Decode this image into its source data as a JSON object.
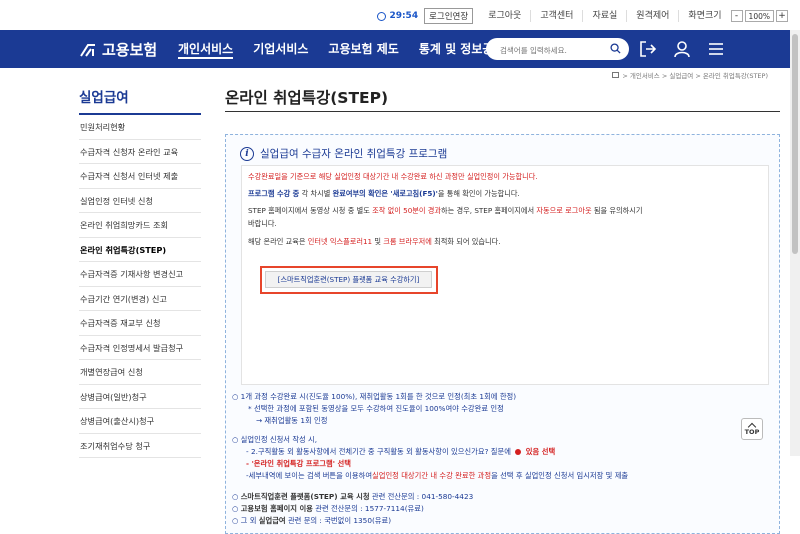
{
  "topbar": {
    "timer": "29:54",
    "extend": "로그인연장",
    "logout": "로그아웃",
    "customer": "고객센터",
    "library": "자료실",
    "remote": "원격제어",
    "screen": "화면크기",
    "zoom_minus": "-",
    "zoom_value": "100%",
    "zoom_plus": "+"
  },
  "nav": {
    "logo": "고용보험",
    "menu": [
      "개인서비스",
      "기업서비스",
      "고용보험 제도",
      "통계 및 정보공개"
    ],
    "search_placeholder": "검색어를 입력하세요."
  },
  "breadcrumb": "> 개인서비스 > 실업급여 > 온라인 취업특강(STEP)",
  "sidebar": {
    "title": "실업급여",
    "items": [
      "민원처리현황",
      "수급자격 신청자 온라인 교육",
      "수급자격 신청서 인터넷 제출",
      "실업인정 인터넷 신청",
      "온라인 취업희망카드 조회",
      "온라인 취업특강(STEP)",
      "수급자격증 기재사항 변경신고",
      "수급기간 연기(변경) 신고",
      "수급자격증 재교부 신청",
      "수급자격 인정명세서 발급청구",
      "개별연장급여 신청",
      "상병급여(일반)청구",
      "상병급여(출산시)청구",
      "조기재취업수당 청구"
    ]
  },
  "main": {
    "title": "온라인 취업특강(STEP)",
    "box_title": "실업급여 수급자 온라인 취업특강 프로그램",
    "line1": "수강완료일을 기준으로 해당 실업인정 대상기간 내 수강완료 하신 과정만 실업인정이 가능합니다.",
    "line2a": "프로그램 수강 중",
    "line2b": " 각 차시별 ",
    "line2c": "완료여부의 확인은 '새로고침(F5)'",
    "line2d": "을 통해 확인이 가능합니다.",
    "line3a": "STEP 홈페이지에서 동영상 시청 중 별도 ",
    "line3b": "조작 없이 50분이 경과",
    "line3c": "하는 경우, STEP 홈페이지에서 ",
    "line3d": "자동으로 로그아웃",
    "line3e": " 됨을 유의하시기",
    "line3f": "바랍니다.",
    "line4a": "해당 온라인 교육은 ",
    "line4b": "인터넷 익스플로러11",
    "line4c": " 및 ",
    "line4d": "크롬 브라우저에",
    "line4e": " 최적화 되어 있습니다.",
    "cta": "[스마트직업훈련(STEP) 플랫폼 교육 수강하기]",
    "b1": "○ 1개 과정 수강완료 시(진도율 100%), 재취업활동 1회를 한 것으로 인정(최초 1회에 한정)",
    "b1s": "* 선택한 과정에 포함된 동영상을 모두 수강하여 진도율이 100%여야 수강완료 인정",
    "b1s2": "→ 재취업활동 1회 인정",
    "b2": "○ 실업인정 신청서 작성 시,",
    "b2a1": "- 2.구직활동 외 활동사항에서 전체기간 중 구직활동 외 활동사항이 있으신가요? 질문에 ",
    "b2a2": " 있음 선택",
    "b2b": "- '온라인 취업특강 프로그램' 선택",
    "b2c1": "-세부내역에 보이는 검색 버튼을 이용하여",
    "b2c2": "실업인정 대상기간 내 수강 완료한 과정",
    "b2c3": "을 선택 후 실업인정 신청서 임시저장 및 제출",
    "c1a": "○ ",
    "c1b": "스마트직업훈련 플랫폼(STEP) 교육 시청",
    "c1c": " 관련 전산문의 : 041-580-4423",
    "c2a": "○ ",
    "c2b": "고용보험 홈페이지 이용",
    "c2c": " 관련 전산문의 : 1577-7114(유료)",
    "c3a": "○ 그 외 ",
    "c3b": "실업급여",
    "c3c": " 관련 문의 : 국번없이 1350(유료)"
  },
  "top_button": "TOP",
  "colors": {
    "brand": "#1b3a94",
    "accent_red": "#d41f1f",
    "cta_border": "#e7452b"
  }
}
